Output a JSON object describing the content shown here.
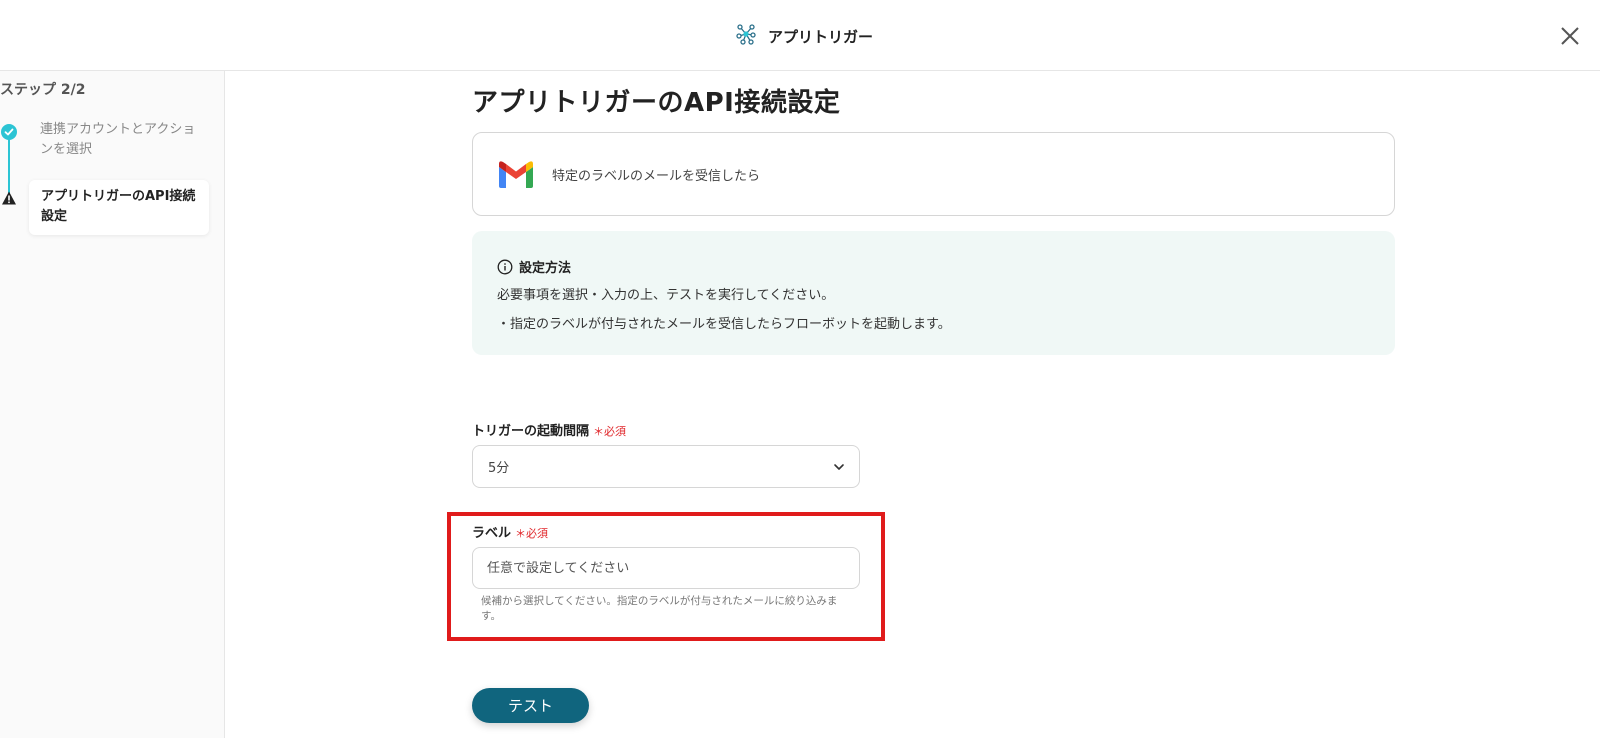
{
  "header": {
    "title": "アプリトリガー",
    "title_icon": "app-trigger-network-icon",
    "close_icon": "close-icon"
  },
  "sidebar": {
    "step_count": "ステップ 2/2",
    "steps": [
      {
        "label": "連携アカウントとアクションを選択",
        "status": "completed",
        "icon": "check-circle-icon"
      },
      {
        "label": "アプリトリガーのAPI接続設定",
        "status": "current",
        "icon": "warning-icon"
      }
    ]
  },
  "main": {
    "heading": "アプリトリガーのAPI接続設定",
    "event": {
      "icon": "gmail-icon",
      "label": "特定のラベルのメールを受信したら"
    },
    "info": {
      "title": "設定方法",
      "line1": "必要事項を選択・入力の上、テストを実行してください。",
      "line2": "・指定のラベルが付与されたメールを受信したらフローボットを起動します。"
    },
    "interval_field": {
      "label": "トリガーの起動間隔",
      "required_text": "＊必須",
      "value": "5分"
    },
    "label_field": {
      "label": "ラベル",
      "required_text": "＊必須",
      "placeholder": "任意で設定してください",
      "value": "",
      "help": "候補から選択してください。指定のラベルが付与されたメールに絞り込みます。"
    },
    "test_button": "テスト"
  },
  "colors": {
    "accent": "#2cc4d4",
    "primary_button": "#10657e",
    "required": "#e0262a",
    "highlight": "#e01b1b",
    "info_bg": "#f0f8f6"
  }
}
